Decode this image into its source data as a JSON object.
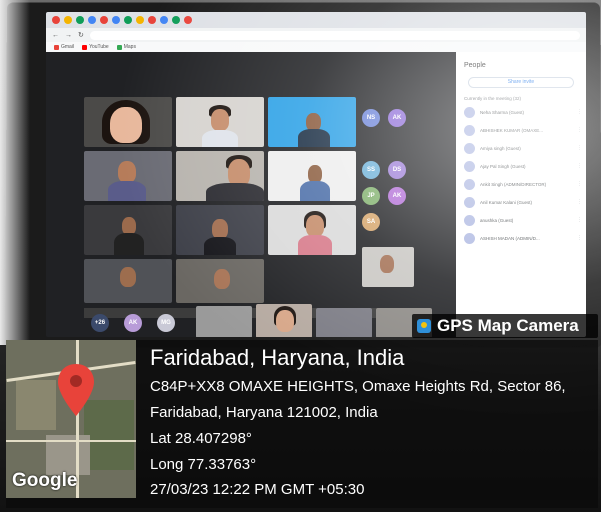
{
  "screen": {
    "bookmarks": [
      "Gmail",
      "YouTube",
      "Maps"
    ],
    "people_panel": {
      "title": "People",
      "invite_label": "Share invite",
      "section_label": "Currently in the meeting (32)",
      "participants": [
        "Neha Sharma (Guest)",
        "ABHISHEK KUMAR (OMAXE...",
        "Amiya singh (Guest)",
        "Ajay Pal Singh (Guest)",
        "Ankit Singh (ADMIN/DIRECTOR)",
        "Anil Kumar Kalani (Guest)",
        "anushka (Guest)",
        "ASHISH MADAN (ADMIN/D..."
      ]
    },
    "avatars": [
      "NS",
      "AK",
      "SS",
      "DS",
      "JP",
      "AK",
      "SA"
    ],
    "bottom_avatars": [
      "+26",
      "AK",
      "MG"
    ]
  },
  "gps_overlay": {
    "badge_title": "GPS Map Camera",
    "location_title": "Faridabad, Haryana, India",
    "address_line1": "C84P+XX8 OMAXE HEIGHTS, Omaxe Heights Rd, Sector 86,",
    "address_line2": "Faridabad, Haryana 121002, India",
    "latitude": "Lat 28.407298°",
    "longitude": "Long 77.33763°",
    "timestamp": "27/03/23 12:22 PM GMT +05:30",
    "map_brand": "Google"
  },
  "colors": {
    "pin": "#e8433a",
    "meet_bg": "#202124",
    "overlay_bg": "#0a0a0a"
  },
  "icons": [
    "location-pin-icon",
    "gps-camera-logo-icon",
    "microphone-icon"
  ]
}
